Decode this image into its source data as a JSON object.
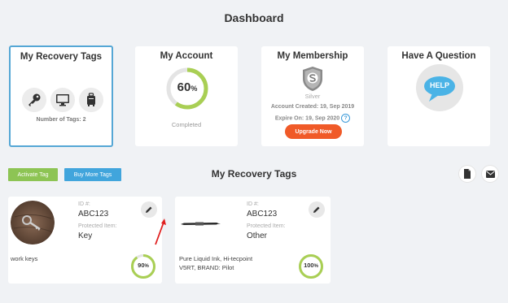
{
  "page": {
    "title": "Dashboard"
  },
  "cards": {
    "recovery_tags": {
      "title": "My Recovery Tags",
      "num_tags_label": "Number of Tags: 2"
    },
    "account": {
      "title": "My Account",
      "percent": "60",
      "percent_sign": "%",
      "status": "Completed",
      "progress": 0.6
    },
    "membership": {
      "title": "My Membership",
      "level": "Silver",
      "account_created": "Account Created: 19, Sep 2019",
      "expire_on": "Expire On: 19, Sep 2020",
      "upgrade_label": "Upgrade Now"
    },
    "question": {
      "title": "Have A Question",
      "help_label": "HELP"
    }
  },
  "actions": {
    "activate_label": "Activate Tag",
    "buy_more_label": "Buy More Tags"
  },
  "section": {
    "title": "My Recovery Tags"
  },
  "tags": [
    {
      "id_label": "ID #:",
      "id": "ABC123",
      "item_label": "Protected Item:",
      "item": "Key",
      "description": "work keys",
      "description_line2": "",
      "percent": "90",
      "percent_sign": "%",
      "progress": 0.9
    },
    {
      "id_label": "ID #:",
      "id": "ABC123",
      "item_label": "Protected Item:",
      "item": "Other",
      "description": "Pure Liquid Ink, Hi-tecpoint",
      "description_line2": "V5RT, BRAND: Pilot",
      "percent": "100",
      "percent_sign": "%",
      "progress": 1.0
    }
  ],
  "colors": {
    "accent_green": "#a9cf54",
    "accent_blue": "#41a5dc",
    "accent_orange": "#f05a28",
    "red_arrow": "#e02020"
  },
  "icons": [
    "key-icon",
    "monitor-icon",
    "suitcase-icon",
    "shield-s-icon",
    "help-bubble-icon",
    "document-icon",
    "mail-icon",
    "pencil-icon"
  ]
}
